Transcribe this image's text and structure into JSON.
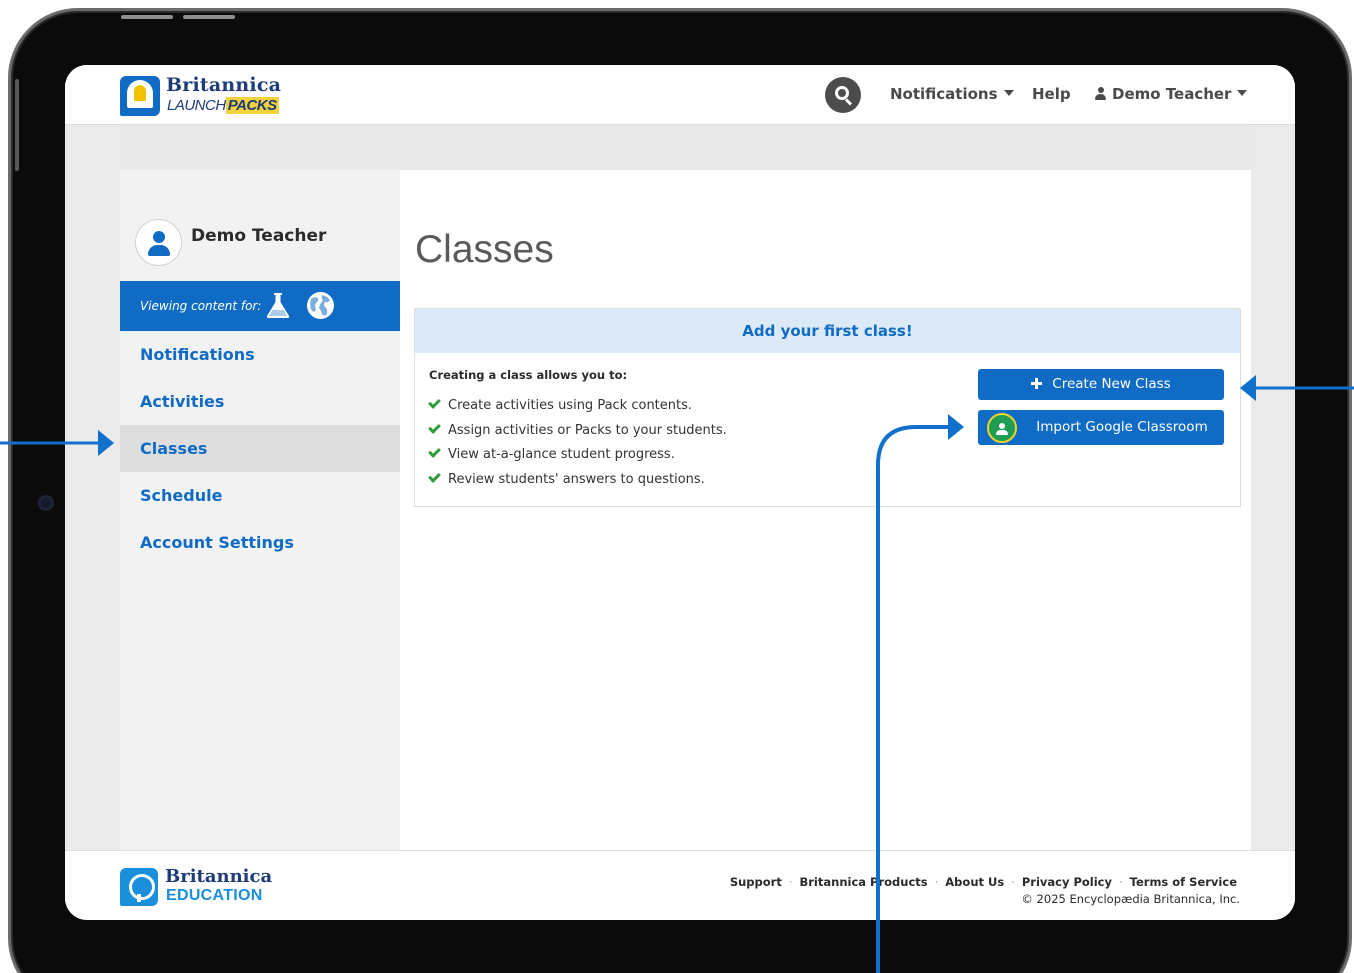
{
  "colors": {
    "brand_blue": "#0f6bc4",
    "brand_navy": "#1d3c78",
    "header_tint": "#dbeaf6",
    "check_green": "#2e9c3a",
    "annotation_blue": "#1070cc"
  },
  "header": {
    "logo": {
      "line1": "Britannica",
      "line2_prefix": "LAUNCH",
      "line2_badge": "PACKS",
      "icon": "britannica-thistle-logo-icon"
    },
    "search_icon": "search-icon",
    "nav": {
      "notifications_label": "Notifications",
      "help_label": "Help",
      "user_label": "Demo Teacher"
    }
  },
  "sidebar": {
    "profile_name": "Demo Teacher",
    "viewing_label": "Viewing content for:",
    "content_icons": [
      "flask-icon",
      "globe-icon"
    ],
    "items": [
      {
        "label": "Notifications",
        "active": false
      },
      {
        "label": "Activities",
        "active": false
      },
      {
        "label": "Classes",
        "active": true
      },
      {
        "label": "Schedule",
        "active": false
      },
      {
        "label": "Account Settings",
        "active": false
      }
    ]
  },
  "main": {
    "title": "Classes",
    "card": {
      "heading": "Add your first class!",
      "lead": "Creating a class allows you to:",
      "benefits": [
        "Create activities using Pack contents.",
        "Assign activities or Packs to your students.",
        "View at-a-glance student progress.",
        "Review students' answers to questions."
      ],
      "create_button_label": "Create New Class",
      "import_button_label": "Import Google Classroom"
    }
  },
  "footer": {
    "logo": {
      "line1": "Britannica",
      "line2": "EDUCATION"
    },
    "links": [
      "Support",
      "Britannica Products",
      "About Us",
      "Privacy Policy",
      "Terms of Service"
    ],
    "copyright": "© 2025 Encyclopædia Britannica, Inc."
  }
}
